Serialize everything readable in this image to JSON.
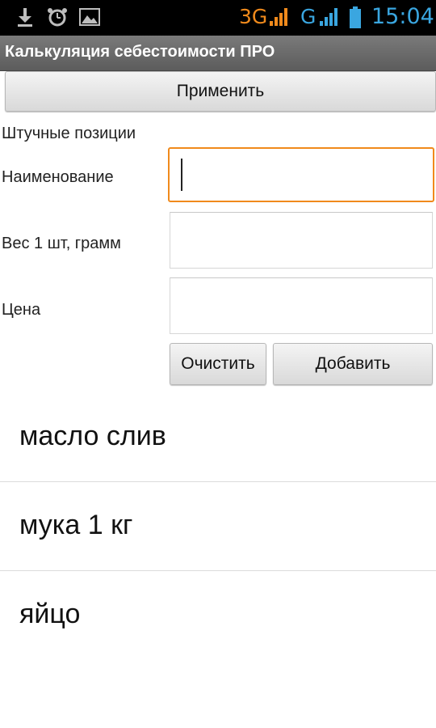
{
  "status_bar": {
    "left_icons": [
      "download-icon",
      "alarm-icon",
      "image-icon"
    ],
    "network_3g": "3G",
    "network_g": "G",
    "time": "15:04",
    "colors": {
      "network_3g": "#f08a1c",
      "network_g": "#3aa6e0",
      "time": "#3aa6e0"
    }
  },
  "title_bar": {
    "title": "Калькуляция себестоимости ПРО"
  },
  "apply_button": {
    "label": "Применить"
  },
  "form": {
    "section_title": "Штучные позиции",
    "name_label": "Наименование",
    "name_value": "",
    "weight_label": "Вес 1 шт, грамм",
    "weight_value": "",
    "price_label": "Цена",
    "price_value": "",
    "clear_label": "Очистить",
    "add_label": "Добавить",
    "focus_color": "#f08a1c"
  },
  "items": [
    {
      "name": "масло слив"
    },
    {
      "name": "мука 1 кг"
    },
    {
      "name": "яйцо"
    }
  ]
}
